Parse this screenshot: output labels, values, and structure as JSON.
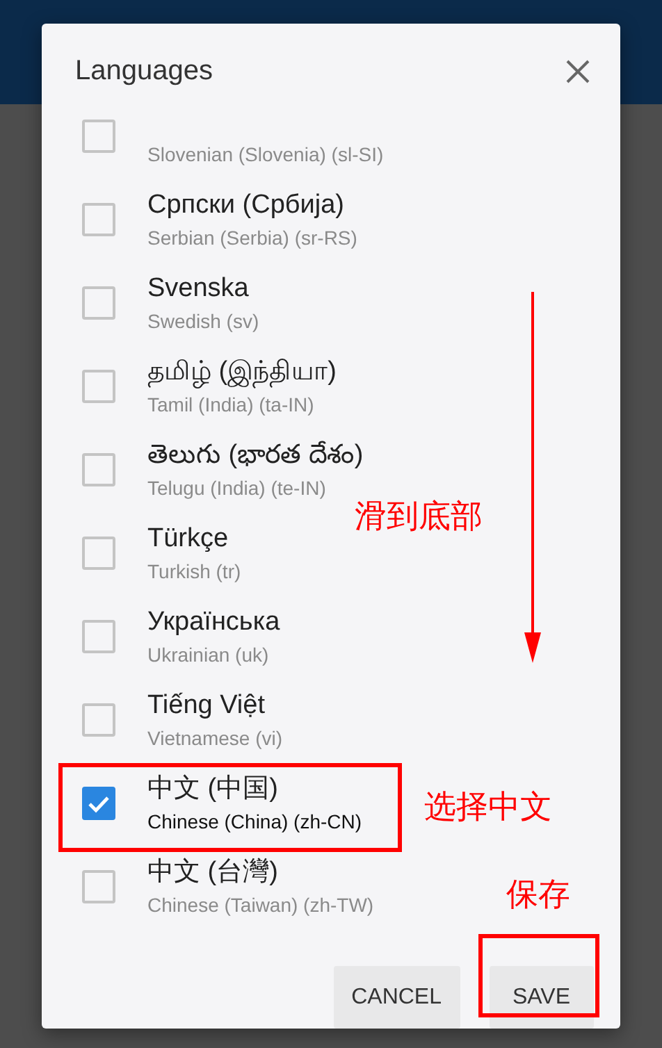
{
  "dialog": {
    "title": "Languages",
    "languages": [
      {
        "detail": "Slovenian (Slovenia) (sl-SI)",
        "checked": false
      },
      {
        "name": "Српски (Србија)",
        "detail": "Serbian (Serbia) (sr-RS)",
        "checked": false
      },
      {
        "name": "Svenska",
        "detail": "Swedish (sv)",
        "checked": false
      },
      {
        "name": "தமிழ் (இந்தியா)",
        "detail": "Tamil (India) (ta-IN)",
        "checked": false
      },
      {
        "name": "తెలుగు (భారత దేశం)",
        "detail": "Telugu (India) (te-IN)",
        "checked": false
      },
      {
        "name": "Türkçe",
        "detail": "Turkish (tr)",
        "checked": false
      },
      {
        "name": "Українська",
        "detail": "Ukrainian (uk)",
        "checked": false
      },
      {
        "name": "Tiếng Việt",
        "detail": "Vietnamese (vi)",
        "checked": false
      },
      {
        "name": "中文 (中国)",
        "detail": "Chinese (China) (zh-CN)",
        "checked": true
      },
      {
        "name": "中文 (台灣)",
        "detail": "Chinese (Taiwan) (zh-TW)",
        "checked": false
      }
    ],
    "buttons": [
      {
        "label": "CANCEL"
      },
      {
        "label": "SAVE"
      }
    ]
  },
  "annotations": [
    {
      "kind": "text",
      "text": "滑到底部"
    },
    {
      "kind": "arrow"
    },
    {
      "kind": "box"
    },
    {
      "kind": "text",
      "text": "选择中文"
    },
    {
      "kind": "text",
      "text": "保存"
    },
    {
      "kind": "box"
    }
  ]
}
